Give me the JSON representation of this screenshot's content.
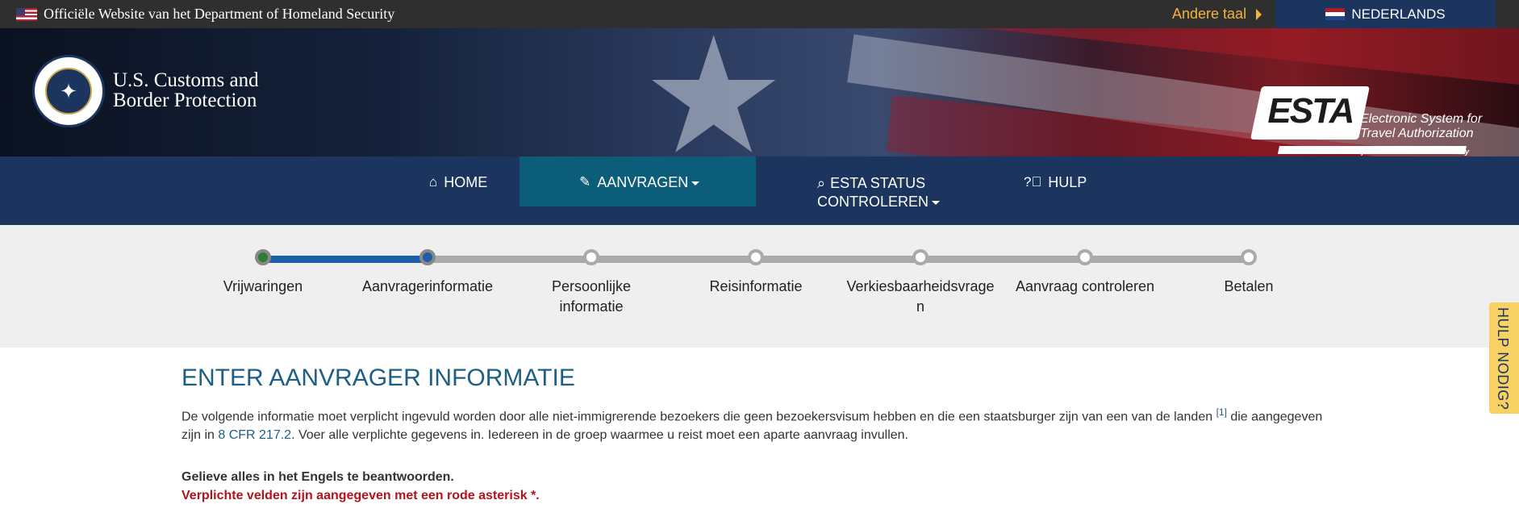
{
  "topbar": {
    "official_text": "Officiële Website van het Department of Homeland Security",
    "other_language": "Andere taal",
    "language": "NEDERLANDS"
  },
  "header": {
    "agency_line1": "U.S. Customs and",
    "agency_line2": "Border Protection",
    "esta_logo": "ESTA",
    "esta_line1": "Electronic System for",
    "esta_line2": "Travel Authorization",
    "esta_dhs": "U.S. Department of Homeland Security"
  },
  "nav": {
    "home": "HOME",
    "apply": "AANVRAGEN",
    "status_line1": "ESTA STATUS",
    "status_line2": "CONTROLEREN",
    "help": "HULP"
  },
  "progress": {
    "current_step_index": 1,
    "steps": [
      {
        "label": "Vrijwaringen"
      },
      {
        "label": "Aanvragerinformatie"
      },
      {
        "label": "Persoonlijke informatie"
      },
      {
        "label": "Reisinformatie"
      },
      {
        "label": "Verkiesbaarheidsvragen"
      },
      {
        "label": "Aanvraag controleren"
      },
      {
        "label": "Betalen"
      }
    ]
  },
  "help_tab": "HULP NODIG?",
  "main": {
    "title": "ENTER AANVRAGER INFORMATIE",
    "intro_part1": "De volgende informatie moet verplicht ingevuld worden door alle niet-immigrerende bezoekers die geen bezoekersvisum hebben en die een staatsburger zijn van een van de landen ",
    "footnote": "[1]",
    "intro_part2": " die aangegeven zijn in ",
    "cfr_link": "8 CFR 217.2",
    "intro_part3": ". Voer alle verplichte gegevens in. Iedereen in de groep waarmee u reist moet een aparte aanvraag invullen.",
    "english_note": "Gelieve alles in het Engels te beantwoorden.",
    "required_note": "Verplichte velden zijn aangegeven met een rode asterisk *."
  }
}
